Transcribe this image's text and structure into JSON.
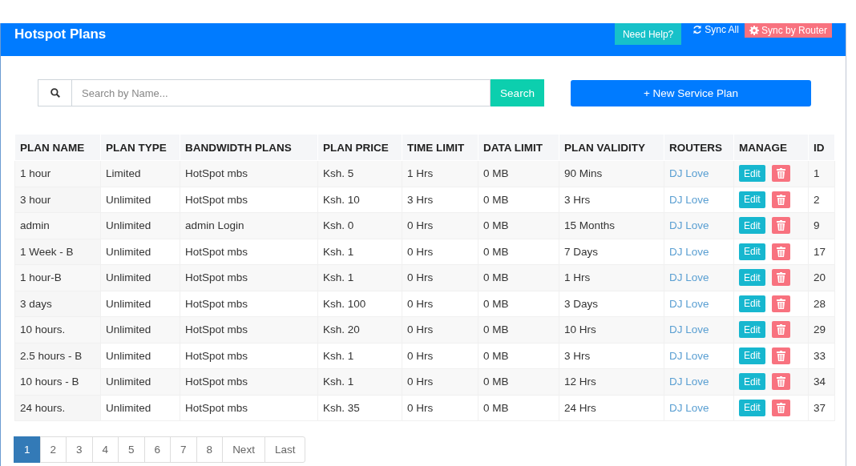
{
  "header": {
    "title": "Hotspot Plans",
    "help_button": "Need Help?",
    "sync_all": "Sync All",
    "sync_router": "Sync by Router"
  },
  "search": {
    "placeholder": "Search by Name...",
    "button": "Search"
  },
  "new_plan_button": "+ New Service Plan",
  "table": {
    "columns": [
      "PLAN NAME",
      "PLAN TYPE",
      "BANDWIDTH PLANS",
      "PLAN PRICE",
      "TIME LIMIT",
      "DATA LIMIT",
      "PLAN VALIDITY",
      "ROUTERS",
      "MANAGE",
      "ID"
    ],
    "rows": [
      {
        "name": "1 hour",
        "type": "Limited",
        "bandwidth": "HotSpot mbs",
        "price": "Ksh. 5",
        "time": "1 Hrs",
        "data": "0 MB",
        "validity": "90 Mins",
        "router": "DJ Love",
        "edit": "Edit",
        "id": "1"
      },
      {
        "name": "3 hour",
        "type": "Unlimited",
        "bandwidth": "HotSpot mbs",
        "price": "Ksh. 10",
        "time": "3 Hrs",
        "data": "0 MB",
        "validity": "3 Hrs",
        "router": "DJ Love",
        "edit": "Edit",
        "id": "2"
      },
      {
        "name": "admin",
        "type": "Unlimited",
        "bandwidth": "admin Login",
        "price": "Ksh. 0",
        "time": "0 Hrs",
        "data": "0 MB",
        "validity": "15 Months",
        "router": "DJ Love",
        "edit": "Edit",
        "id": "9"
      },
      {
        "name": "1 Week - B",
        "type": "Unlimited",
        "bandwidth": "HotSpot mbs",
        "price": "Ksh. 1",
        "time": "0 Hrs",
        "data": "0 MB",
        "validity": "7 Days",
        "router": "DJ Love",
        "edit": "Edit",
        "id": "17"
      },
      {
        "name": "1 hour-B",
        "type": "Unlimited",
        "bandwidth": "HotSpot mbs",
        "price": "Ksh. 1",
        "time": "0 Hrs",
        "data": "0 MB",
        "validity": "1 Hrs",
        "router": "DJ Love",
        "edit": "Edit",
        "id": "20"
      },
      {
        "name": "3 days",
        "type": "Unlimited",
        "bandwidth": "HotSpot mbs",
        "price": "Ksh. 100",
        "time": "0 Hrs",
        "data": "0 MB",
        "validity": "3 Days",
        "router": "DJ Love",
        "edit": "Edit",
        "id": "28"
      },
      {
        "name": "10 hours.",
        "type": "Unlimited",
        "bandwidth": "HotSpot mbs",
        "price": "Ksh. 20",
        "time": "0 Hrs",
        "data": "0 MB",
        "validity": "10 Hrs",
        "router": "DJ Love",
        "edit": "Edit",
        "id": "29"
      },
      {
        "name": "2.5 hours - B",
        "type": "Unlimited",
        "bandwidth": "HotSpot mbs",
        "price": "Ksh. 1",
        "time": "0 Hrs",
        "data": "0 MB",
        "validity": "3 Hrs",
        "router": "DJ Love",
        "edit": "Edit",
        "id": "33"
      },
      {
        "name": "10 hours - B",
        "type": "Unlimited",
        "bandwidth": "HotSpot mbs",
        "price": "Ksh. 1",
        "time": "0 Hrs",
        "data": "0 MB",
        "validity": "12 Hrs",
        "router": "DJ Love",
        "edit": "Edit",
        "id": "34"
      },
      {
        "name": "24 hours.",
        "type": "Unlimited",
        "bandwidth": "HotSpot mbs",
        "price": "Ksh. 35",
        "time": "0 Hrs",
        "data": "0 MB",
        "validity": "24 Hrs",
        "router": "DJ Love",
        "edit": "Edit",
        "id": "37"
      }
    ]
  },
  "pagination": [
    {
      "label": "1",
      "selected": true
    },
    {
      "label": "2",
      "selected": false
    },
    {
      "label": "3",
      "selected": false
    },
    {
      "label": "4",
      "selected": false
    },
    {
      "label": "5",
      "selected": false
    },
    {
      "label": "6",
      "selected": false
    },
    {
      "label": "7",
      "selected": false
    },
    {
      "label": "8",
      "selected": false
    },
    {
      "label": "Next",
      "selected": false
    },
    {
      "label": "Last",
      "selected": false
    }
  ]
}
